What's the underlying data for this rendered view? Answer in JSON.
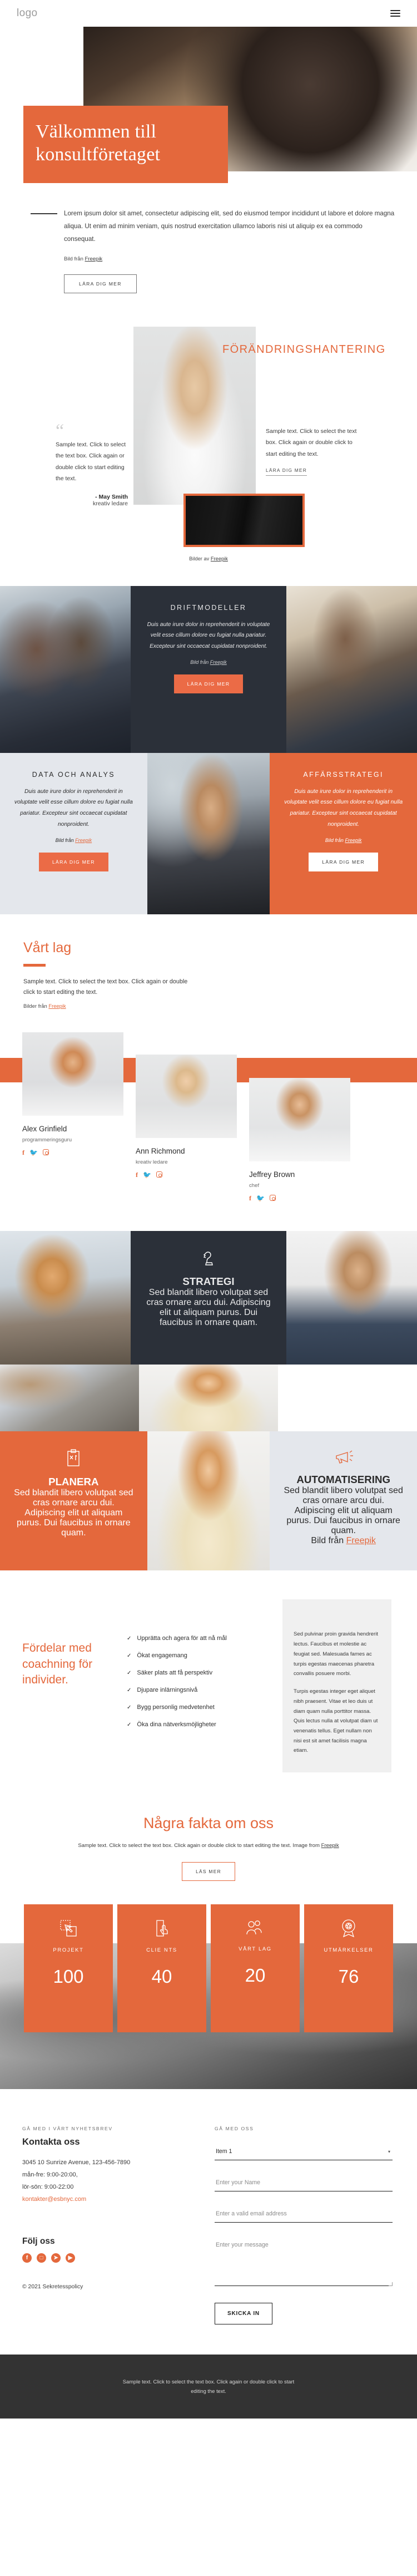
{
  "header": {
    "logo": "logo",
    "menu_icon": "hamburger-icon"
  },
  "hero": {
    "title": "Välkommen till konsultföretaget",
    "body": "Lorem ipsum dolor sit amet, consectetur adipiscing elit, sed do eiusmod tempor incididunt ut labore et dolore magna aliqua. Ut enim ad minim veniam, quis nostrud exercitation ullamco laboris nisi ut aliquip ex ea commodo consequat.",
    "credit_prefix": "Bild från ",
    "credit_link": "Freepik",
    "button": "LÄRA DIG MER"
  },
  "change_mgmt": {
    "title": "FÖRÄNDRINGSHANTERING",
    "quote": "Sample text. Click to select the text box. Click again or double click to start editing the text.",
    "author": "- May Smith",
    "author_role": "kreativ ledare",
    "right_text": "Sample text. Click to select the text box. Click again or double click to start editing the text.",
    "right_link": "LÄRA DIG MER",
    "images_credit_prefix": "Bilder av ",
    "images_credit_link": "Freepik"
  },
  "services": {
    "body": "Duis aute irure dolor in reprehenderit in voluptate velit esse cillum dolore eu fugiat nulla pariatur. Excepteur sint occaecat cupidatat nonproident.",
    "credit_prefix": "Bild från ",
    "credit_link": "Freepik",
    "button": "LÄRA DIG MER",
    "items": [
      {
        "title": "DRIFTMODELLER",
        "theme": "dark"
      },
      {
        "title": "DATA OCH ANALYS",
        "theme": "grey"
      },
      {
        "title": "AFFÄRSSTRATEGI",
        "theme": "orange"
      }
    ]
  },
  "team": {
    "title": "Vårt lag",
    "body": "Sample text. Click to select the text box. Click again or double click to start editing the text.",
    "credit_prefix": "Bilder från ",
    "credit_link": "Freepik",
    "members": [
      {
        "name": "Alex Grinfield",
        "role": "programmeringsguru"
      },
      {
        "name": "Ann Richmond",
        "role": "kreativ ledare"
      },
      {
        "name": "Jeffrey Brown",
        "role": "chef"
      }
    ],
    "social_icons": [
      "facebook-icon",
      "twitter-icon",
      "instagram-icon"
    ]
  },
  "mosaic": {
    "body": "Sed blandit libero volutpat sed cras ornare arcu dui. Adipiscing elit ut aliquam purus. Dui faucibus in ornare quam.",
    "strategi": {
      "title": "STRATEGI",
      "icon": "chess-knight-icon"
    },
    "planera": {
      "title": "PLANERA",
      "icon": "clipboard-plan-icon"
    },
    "automatisering": {
      "title": "AUTOMATISERING",
      "icon": "megaphone-icon"
    },
    "credit_prefix": "Bild från ",
    "credit_link": "Freepik"
  },
  "benefits": {
    "title": "Fördelar med coachning för individer.",
    "items": [
      "Upprätta och agera för att nå mål",
      "Ökat engagemang",
      "Säker plats att få perspektiv",
      "Djupare inlärningsnivå",
      "Bygg personlig medvetenhet",
      "Öka dina nätverksmöjligheter"
    ],
    "side_p1": "Sed pulvinar proin gravida hendrerit lectus. Faucibus et molestie ac feugiat sed. Malesuada fames ac turpis egestas maecenas pharetra convallis posuere morbi.",
    "side_p2": "Turpis egestas integer eget aliquet nibh praesent. Vitae et leo duis ut diam quam nulla porttitor massa. Quis lectus nulla at volutpat diam ut venenatis tellus. Eget nullam non nisi est sit amet facilisis magna etiam."
  },
  "facts": {
    "title": "Några fakta om oss",
    "subtitle": "Sample text. Click to select the text box. Click again or double click to start editing the text. Image from",
    "subtitle_link": "Freepik",
    "button": "LÄS MER",
    "counters": [
      {
        "label": "PROJEKT",
        "value": "100",
        "icon": "design-frame-icon"
      },
      {
        "label": "CLIE NTS",
        "value": "40",
        "icon": "mobile-tap-icon"
      },
      {
        "label": "VÅRT LAG",
        "value": "20",
        "icon": "people-group-icon"
      },
      {
        "label": "UTMÄRKELSER",
        "value": "76",
        "icon": "award-badge-icon"
      }
    ]
  },
  "contact": {
    "eyebrow_left": "GÅ MED I VÅRT NYHETSBREV",
    "title": "Kontakta oss",
    "address_line1": "3045 10 Sunrize Avenue, 123-456-7890",
    "address_line2": "mån-fre: 9:00-20:00,",
    "address_line3": "lör-sön: 9:00-22:00",
    "email": "kontakter@esbnyc.com",
    "follow_title": "Följ oss",
    "social_icons": [
      "facebook-icon",
      "instagram-icon",
      "twitter-icon",
      "youtube-icon"
    ],
    "social_glyphs": [
      "f",
      "□",
      "✓",
      "▶"
    ],
    "copyright": "© 2021 Sekretesspolicy",
    "eyebrow_right": "GÅ MED OSS",
    "select_value": "Item 1",
    "name_placeholder": "Enter your Name",
    "email_placeholder": "Enter a valid email address",
    "message_placeholder": "Enter your message",
    "submit": "SKICKA IN"
  },
  "bottom": {
    "text": "Sample text. Click to select the text box. Click again or double click to start editing the text."
  },
  "colors": {
    "accent": "#e4683c",
    "dark": "#2b3039",
    "grey": "#e4e7ec",
    "footer": "#333333"
  }
}
